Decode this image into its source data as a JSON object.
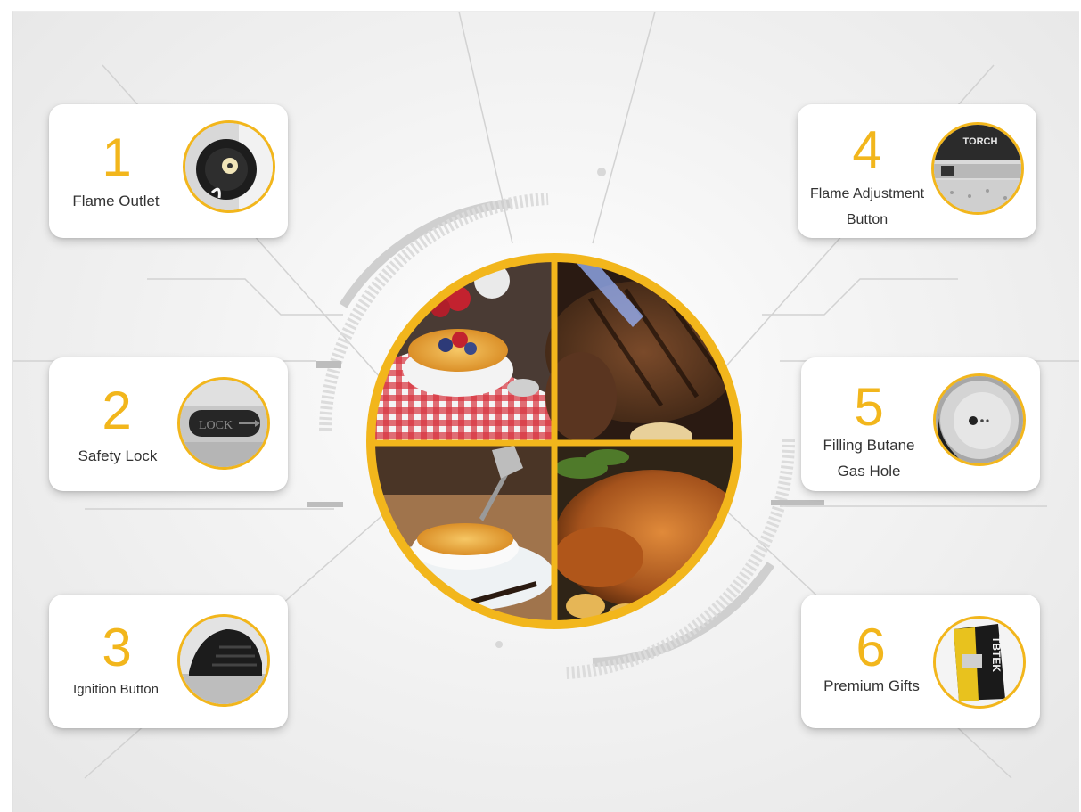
{
  "features": [
    {
      "number": "1",
      "label": "Flame Outlet",
      "icon": "flame-outlet-icon"
    },
    {
      "number": "2",
      "label": "Safety Lock",
      "icon": "lock-icon"
    },
    {
      "number": "3",
      "label": "Ignition Button",
      "icon": "ignition-button-icon"
    },
    {
      "number": "4",
      "label": "Flame Adjustment\nButton",
      "icon": "adjust-knob-icon"
    },
    {
      "number": "5",
      "label": "Filling Butane\nGas Hole",
      "icon": "gas-hole-icon"
    },
    {
      "number": "6",
      "label": "Premium Gifts",
      "icon": "gift-box-icon"
    }
  ],
  "thumb_text": {
    "lock": "LOCK",
    "torch": "TORCH",
    "box_brand": "TBTEK"
  },
  "colors": {
    "accent": "#f2b61c",
    "label": "#333333",
    "card": "#ffffff"
  }
}
